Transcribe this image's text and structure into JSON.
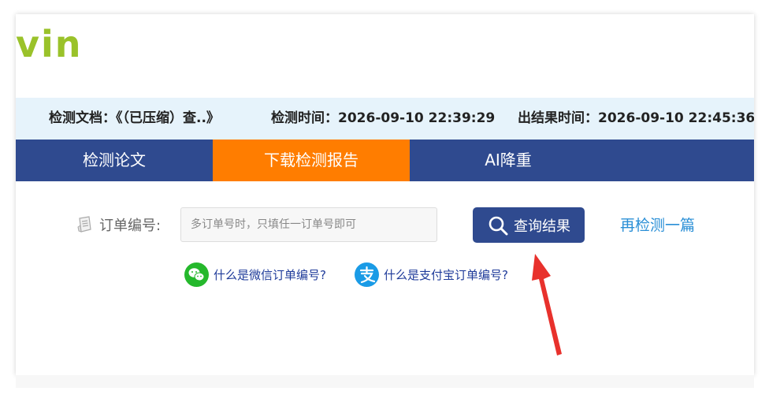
{
  "logo": {
    "text": "vin"
  },
  "info_bar": {
    "document": "检测文档：《（已压缩）查..》",
    "check_time": "检测时间：2026-09-10 22:39:29",
    "result_time": "出结果时间：2026-09-10 22:45:36"
  },
  "tabs": [
    {
      "label": "检测论文"
    },
    {
      "label": "下载检测报告"
    },
    {
      "label": "AI降重"
    }
  ],
  "order": {
    "label": "订单编号:",
    "placeholder": "多订单号时，只填任一订单号即可",
    "value": ""
  },
  "query_button": {
    "label": "查询结果"
  },
  "recheck_link": {
    "label": "再检测一篇"
  },
  "help_links": {
    "wechat": "什么是微信订单编号?",
    "alipay": "什么是支付宝订单编号?"
  },
  "icons": {
    "doc": "document-icon",
    "search": "search-icon",
    "wechat": "wechat-icon",
    "alipay": "alipay-icon",
    "arrow": "red-arrow-annotation"
  },
  "colors": {
    "nav_bg": "#2f4a8f",
    "active_tab": "#ff7d00",
    "info_bg": "#e6f3fb",
    "logo": "#9ac22a",
    "link": "#2a8fd6",
    "annotation": "#e8312c"
  }
}
